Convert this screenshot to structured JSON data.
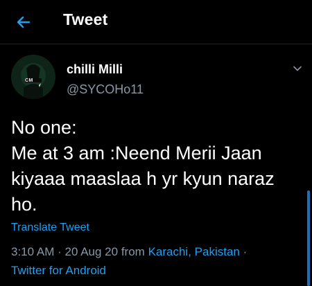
{
  "header": {
    "title": "Tweet",
    "back_icon": "arrow-left-icon",
    "accent": "#1da1f2"
  },
  "tweet": {
    "author_name": "chilli Milli",
    "author_handle": "@SYCOHo11",
    "avatar_text": "CM",
    "caret_icon": "chevron-down-icon",
    "text_lines": [
      "No one:",
      "Me at 3 am :Neend Merii Jaan",
      "kiyaaa maaslaa h yr kyun naraz",
      "ho."
    ],
    "translate_label": "Translate Tweet",
    "time": "3:10 AM",
    "date": "20 Aug 20",
    "from_label": "from",
    "location": "Karachi, Pakistan",
    "separator": "·",
    "source": "Twitter for Android"
  },
  "colors": {
    "background": "#000000",
    "primary_text": "#ffffff",
    "secondary_text": "#8899a6",
    "link": "#1da1f2"
  }
}
